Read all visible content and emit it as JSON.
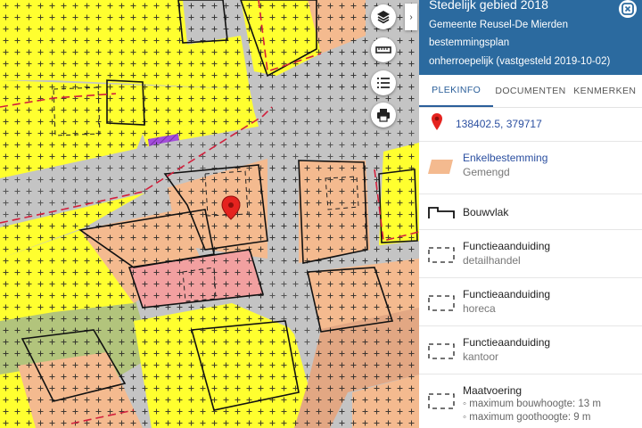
{
  "map": {
    "controls": [
      {
        "name": "layers",
        "label": ""
      },
      {
        "name": "measure",
        "label": ""
      },
      {
        "name": "legend",
        "label": ""
      },
      {
        "name": "print",
        "label": ""
      }
    ],
    "collapse_symbol": "›",
    "colors": {
      "road": "#c4c4c4",
      "residential": "#ffff2f",
      "mixed": "#f4ba8f",
      "center": "#e2a783",
      "greenery": "#b2c47c",
      "culture": "#f2a0a0",
      "purple": "#a34ddb",
      "marker": "#e5231f"
    }
  },
  "panel": {
    "title": "Stedelijk gebied 2018",
    "lines": [
      "Gemeente Reusel-De Mierden",
      "bestemmingsplan",
      "onherroepelijk (vastgesteld 2019-10-02)"
    ],
    "tabs": [
      {
        "label": "PLEKINFO",
        "active": true
      },
      {
        "label": "DOCUMENTEN",
        "active": false
      },
      {
        "label": "KENMERKEN",
        "active": false
      }
    ],
    "coordinates": "138402.5, 379717",
    "entries": [
      {
        "title": "Enkelbestemming",
        "sub": "Gemengd",
        "swatch": "fill",
        "link": true
      },
      {
        "title": "Bouwvlak",
        "sub": "",
        "swatch": "bouwvlak",
        "link": false
      },
      {
        "title": "Functieaanduiding",
        "sub": "detailhandel",
        "swatch": "dashed",
        "link": false
      },
      {
        "title": "Functieaanduiding",
        "sub": "horeca",
        "swatch": "dashed",
        "link": false
      },
      {
        "title": "Functieaanduiding",
        "sub": "kantoor",
        "swatch": "dashed",
        "link": false
      },
      {
        "title": "Maatvoering",
        "bullets": [
          "maximum bouwhoogte: 13 m",
          "maximum goothoogte: 9 m"
        ],
        "swatch": "dashed",
        "link": false
      }
    ],
    "colors": {
      "header": "#2b6a9f",
      "link": "#2b4fa0",
      "swatch_fill": "#f4ba8f"
    }
  }
}
